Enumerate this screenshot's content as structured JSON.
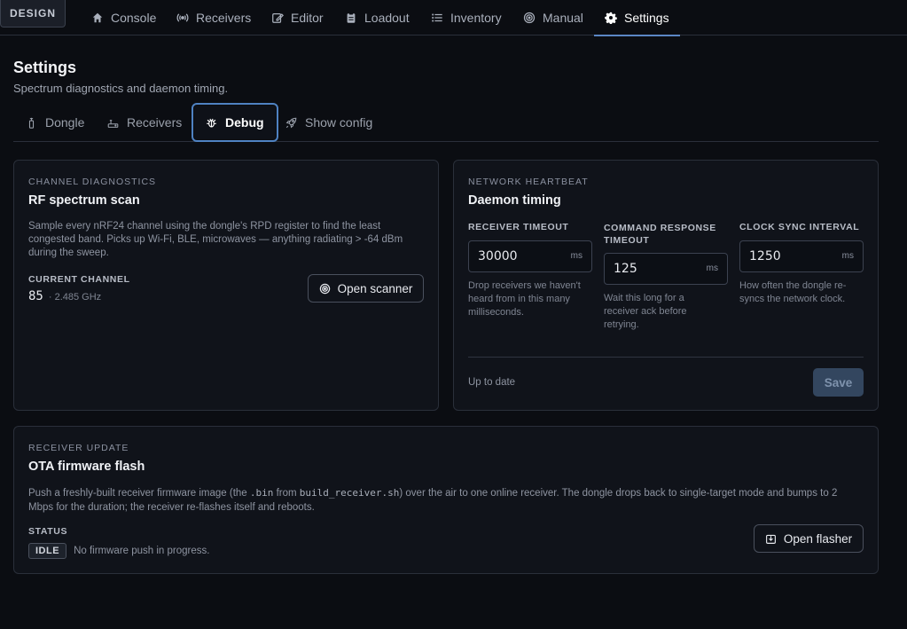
{
  "nav": {
    "design_label": "DESIGN",
    "items": [
      {
        "label": "Console",
        "icon": "home-icon"
      },
      {
        "label": "Receivers",
        "icon": "broadcast-icon"
      },
      {
        "label": "Editor",
        "icon": "edit-icon"
      },
      {
        "label": "Loadout",
        "icon": "clipboard-icon"
      },
      {
        "label": "Inventory",
        "icon": "list-icon"
      },
      {
        "label": "Manual",
        "icon": "target-icon"
      },
      {
        "label": "Settings",
        "icon": "gear-icon",
        "active": true
      }
    ]
  },
  "header": {
    "title": "Settings",
    "subtitle": "Spectrum diagnostics and daemon timing."
  },
  "tabs": [
    {
      "label": "Dongle",
      "icon": "dongle-icon"
    },
    {
      "label": "Receivers",
      "icon": "router-icon"
    },
    {
      "label": "Debug",
      "icon": "bug-icon",
      "active": true
    },
    {
      "label": "Show config",
      "icon": "rocket-icon"
    }
  ],
  "channel_card": {
    "eyebrow": "CHANNEL DIAGNOSTICS",
    "title": "RF spectrum scan",
    "description": "Sample every nRF24 channel using the dongle's RPD register to find the least congested band. Picks up Wi-Fi, BLE, microwaves — anything radiating > -64 dBm during the sweep.",
    "current_label": "CURRENT CHANNEL",
    "channel": "85",
    "frequency": "· 2.485 GHz",
    "button_label": "Open scanner"
  },
  "heartbeat_card": {
    "eyebrow": "NETWORK HEARTBEAT",
    "title": "Daemon timing",
    "fields": [
      {
        "label_line1": "RECEIVER TIMEOUT",
        "label_line2": "",
        "value": "30000",
        "unit": "ms",
        "hint": "Drop receivers we haven't heard from in this many milliseconds."
      },
      {
        "label_line1": "COMMAND RESPONSE",
        "label_line2": "TIMEOUT",
        "value": "125",
        "unit": "ms",
        "hint": "Wait this long for a receiver ack before retrying."
      },
      {
        "label_line1": "CLOCK SYNC INTERVAL",
        "label_line2": "",
        "value": "1250",
        "unit": "ms",
        "hint": "How often the dongle re-syncs the network clock."
      }
    ],
    "status": "Up to date",
    "save_label": "Save"
  },
  "ota_card": {
    "eyebrow": "RECEIVER UPDATE",
    "title": "OTA firmware flash",
    "desc_part1": "Push a freshly-built receiver firmware image (the ",
    "code1": ".bin",
    "desc_part2": " from ",
    "code2": "build_receiver.sh",
    "desc_part3": ") over the air to one online receiver. The dongle drops back to single-target mode and bumps to 2 Mbps for the duration; the receiver re-flashes itself and reboots.",
    "status_label": "STATUS",
    "status_badge": "IDLE",
    "status_text": "No firmware push in progress.",
    "button_label": "Open flasher"
  },
  "colors": {
    "background": "#0b0d12",
    "card": "#10131a",
    "accent": "#5b86c4",
    "save_disabled": "#33465f"
  }
}
